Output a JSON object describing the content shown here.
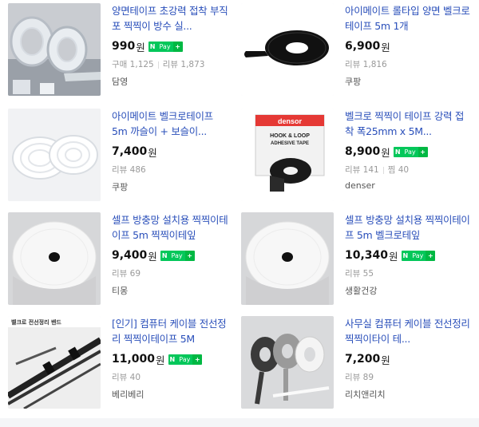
{
  "products": [
    {
      "title": "양면테이프 초강력 접착 부직포 찍찍이 방수 실...",
      "price": "990",
      "won": "원",
      "npay": true,
      "meta": [
        {
          "label": "구매",
          "value": "1,125"
        },
        {
          "label": "리뷰",
          "value": "1,873"
        }
      ],
      "shop": "담영",
      "image": "clear-double-sided-tape"
    },
    {
      "title": "아이메이트 롤타입 양면 벨크로 테이프 5m 1개",
      "price": "6,900",
      "won": "원",
      "npay": false,
      "meta": [
        {
          "label": "리뷰",
          "value": "1,816"
        }
      ],
      "shop": "쿠팡",
      "image": "black-velcro-roll"
    },
    {
      "title": "아이메이트 벨크로테이프 5m 까슬이 + 보슬이...",
      "price": "7,400",
      "won": "원",
      "npay": false,
      "meta": [
        {
          "label": "리뷰",
          "value": "486"
        }
      ],
      "shop": "쿠팡",
      "image": "white-velcro-coils"
    },
    {
      "title": "벨크로 찍찍이 테이프 강력 접착 폭25mm x 5M...",
      "price": "8,900",
      "won": "원",
      "npay": true,
      "meta": [
        {
          "label": "리뷰",
          "value": "141"
        },
        {
          "label": "찜",
          "value": "40"
        }
      ],
      "shop": "denser",
      "image": "denser-hook-loop-box",
      "box_brand": "densor",
      "box_text_1": "HOOK & LOOP",
      "box_text_2": "ADHESIVE TAPE"
    },
    {
      "title": "셀프 방충망 설치용 찍찍이테이프 5m 찍찍이테잎",
      "price": "9,400",
      "won": "원",
      "npay": true,
      "meta": [
        {
          "label": "리뷰",
          "value": "69"
        }
      ],
      "shop": "티몽",
      "image": "white-tape-roll"
    },
    {
      "title": "셀프 방충망 설치용 찍찍이테이프 5m 벨크로테잎",
      "price": "10,340",
      "won": "원",
      "npay": true,
      "meta": [
        {
          "label": "리뷰",
          "value": "55"
        }
      ],
      "shop": "생활건강",
      "image": "white-tape-roll"
    },
    {
      "title": "[인기] 컴퓨터 케이블 전선정리 찍찍이테이프 5M",
      "price": "11,000",
      "won": "원",
      "npay": true,
      "meta": [
        {
          "label": "리뷰",
          "value": "40"
        }
      ],
      "shop": "베리베리",
      "image": "cable-organizer",
      "image_caption": "벨크로 전선정리 밴드"
    },
    {
      "title": "사무실 컴퓨터 케이블 전선정리 찍찍이타이 테...",
      "price": "7,200",
      "won": "원",
      "npay": false,
      "meta": [
        {
          "label": "리뷰",
          "value": "89"
        }
      ],
      "shop": "리치앤리치",
      "image": "grey-cable-tie-rolls"
    }
  ],
  "npay_badge": {
    "n": "N",
    "pay": "Pay",
    "plus": "+"
  },
  "colors": {
    "title_link": "#2a4fba",
    "npay_green": "#03c75a",
    "meta_grey": "#999999"
  }
}
